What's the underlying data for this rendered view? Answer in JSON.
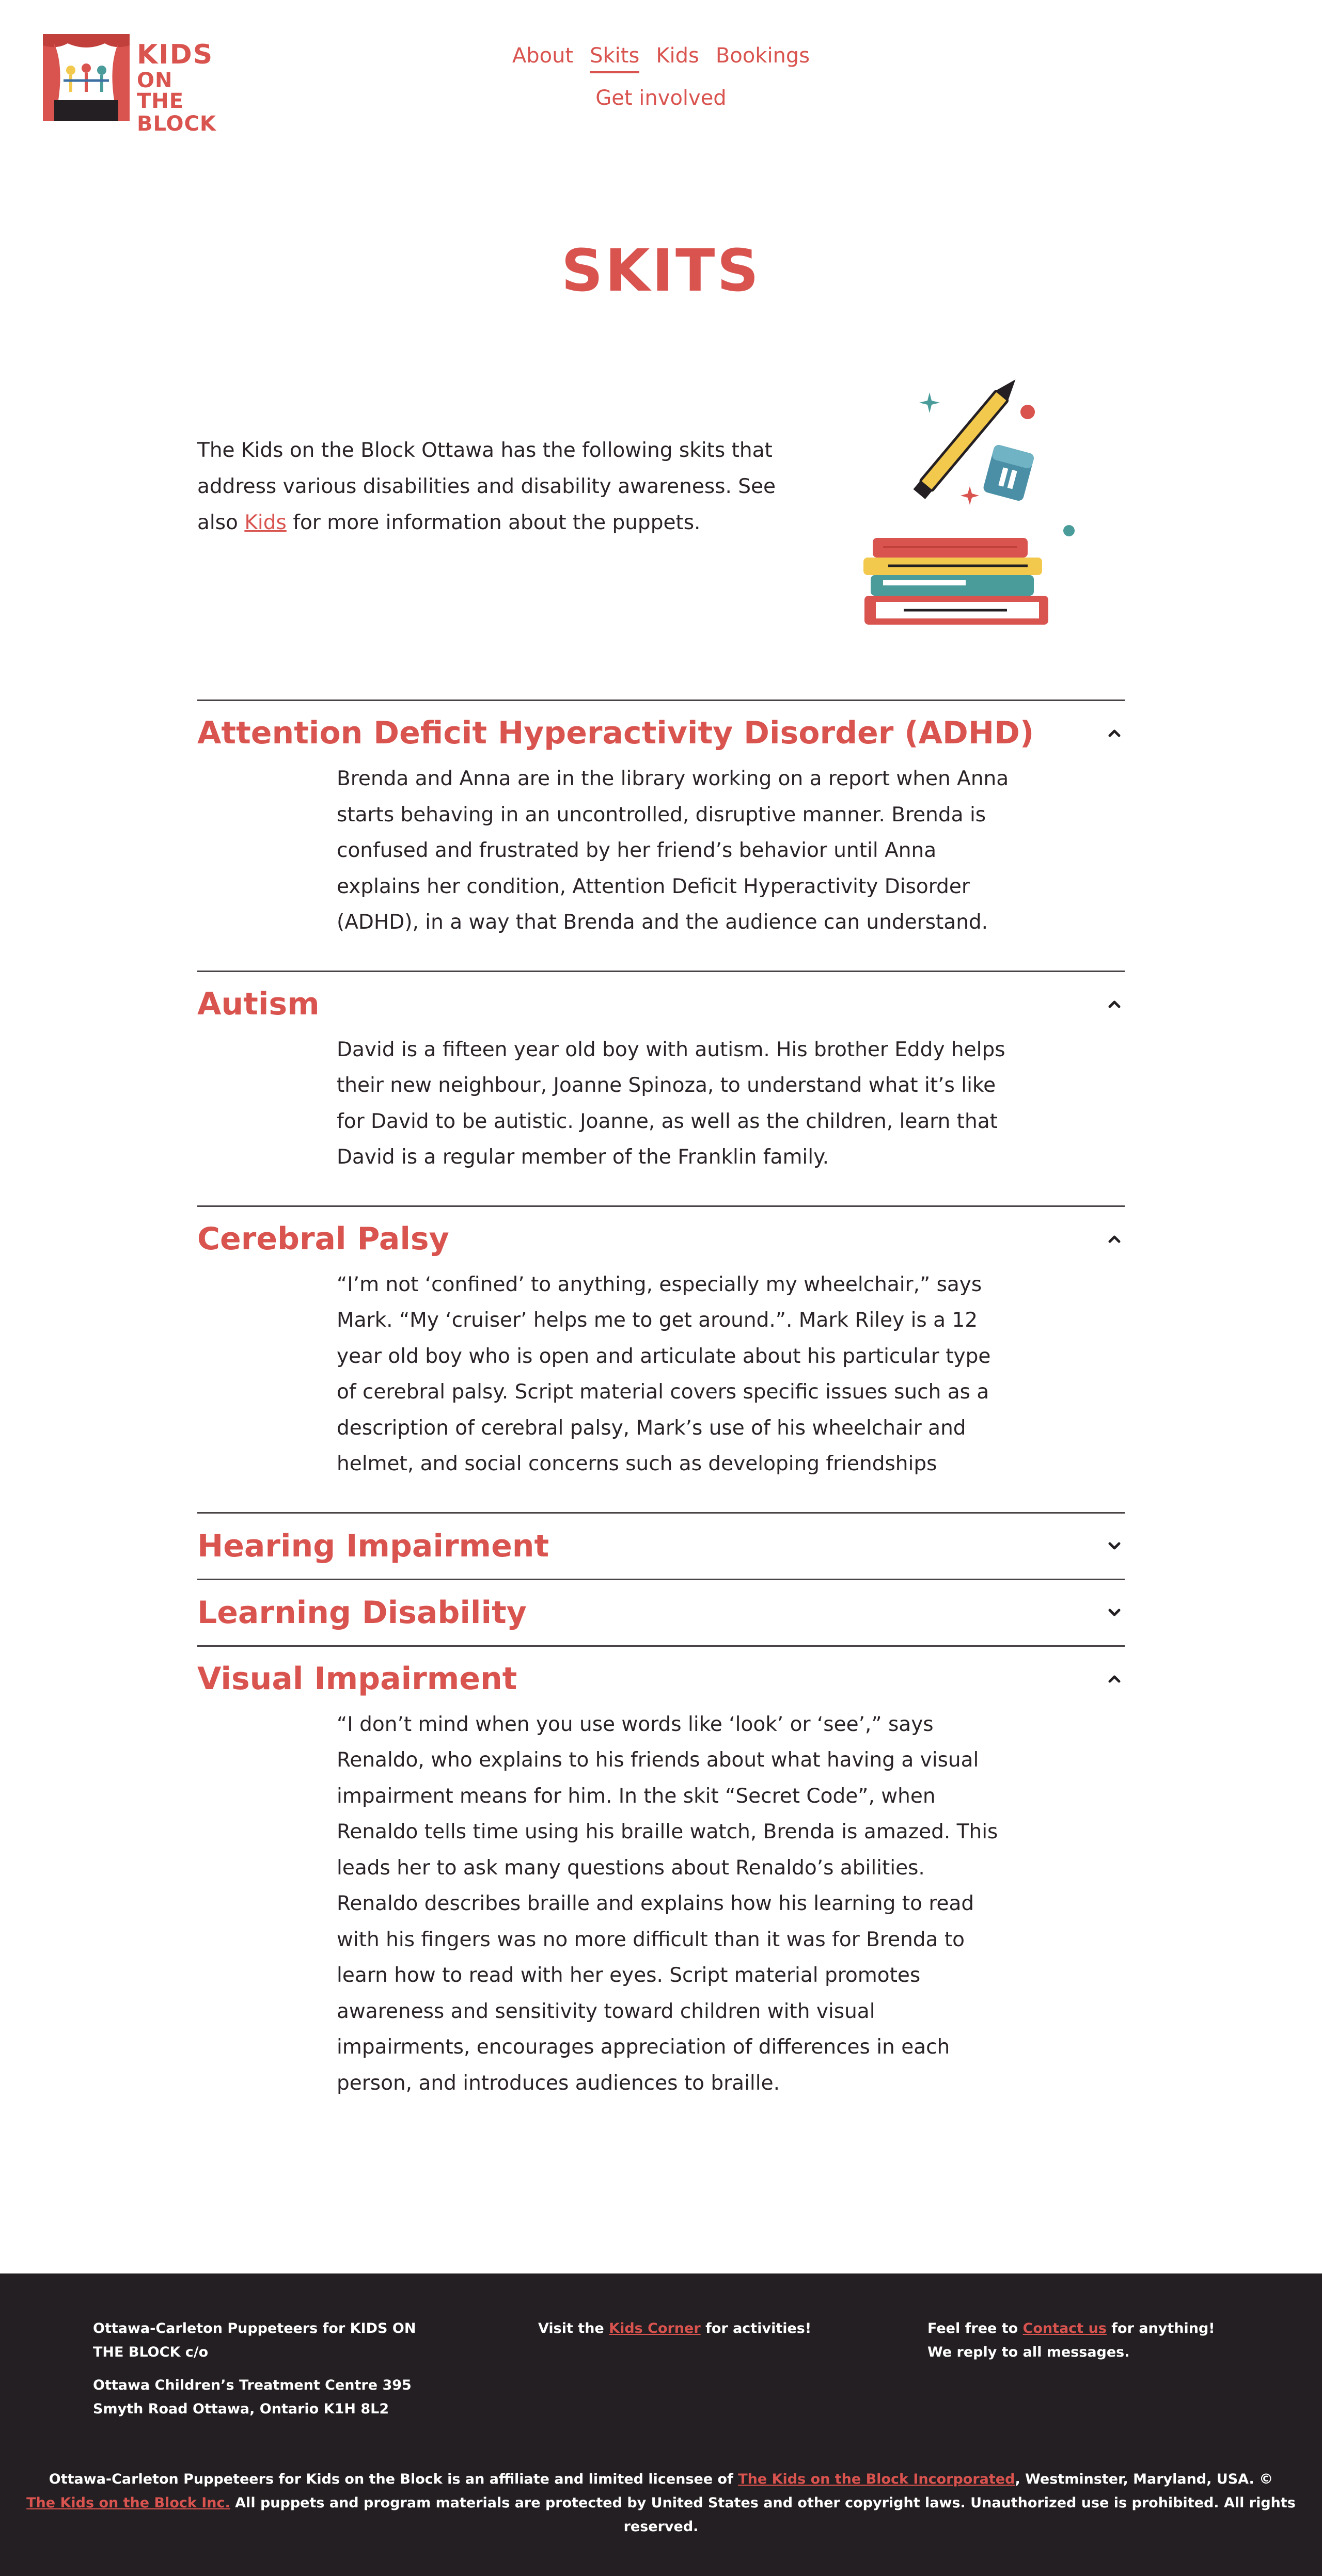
{
  "colors": {
    "accent": "#d9534f",
    "text": "#2a2328",
    "footer_bg": "#231f22",
    "divider": "#4a4448"
  },
  "logo": {
    "line1": "KIDS",
    "line2": "ON THE",
    "line3": "BLOCK"
  },
  "nav": {
    "items": [
      "About",
      "Skits",
      "Kids",
      "Bookings",
      "Get involved"
    ],
    "active": "Skits"
  },
  "page": {
    "title": "SKITS"
  },
  "intro": {
    "before": "The Kids on the Block Ottawa has the following skits that address various disabilities and disability awareness. See also ",
    "link": "Kids",
    "after": " for more information about the puppets."
  },
  "skits": [
    {
      "title": "Attention Deficit Hyperactivity Disorder (ADHD)",
      "expanded": true,
      "chevron": "chevron-up-icon",
      "body": "Brenda and Anna are in the library working on a report when Anna starts behaving in an uncontrolled, disruptive manner. Brenda is confused and frustrated by her friend’s behavior until Anna explains her condition, Attention Deficit Hyperactivity Disorder (ADHD), in a way that Brenda and the audience can understand."
    },
    {
      "title": "Autism",
      "expanded": true,
      "chevron": "chevron-up-icon",
      "body": "David is a fifteen year old boy with autism. His brother Eddy helps their new neighbour, Joanne Spinoza, to understand what it’s like for David to be autistic. Joanne, as well as the children, learn that David is a regular member of the Franklin family."
    },
    {
      "title": "Cerebral Palsy",
      "expanded": true,
      "chevron": "chevron-up-icon",
      "body": "“I’m not ‘confined’ to anything, especially my wheelchair,” says Mark. “My ‘cruiser’ helps me to get around.”. Mark Riley is a 12 year old boy who is open and articulate about his particular type of cerebral palsy. Script material covers specific issues such as a description of cerebral palsy, Mark’s use of his wheelchair and helmet, and social concerns such as developing friendships"
    },
    {
      "title": "Hearing Impairment",
      "expanded": false,
      "chevron": "chevron-down-icon",
      "body": ""
    },
    {
      "title": "Learning Disability",
      "expanded": false,
      "chevron": "chevron-down-icon",
      "body": ""
    },
    {
      "title": "Visual Impairment",
      "expanded": true,
      "chevron": "chevron-up-icon",
      "body": "“I don’t mind when you use words like ‘look’ or ‘see’,” says Renaldo, who explains to his friends about what having a visual impairment means for him. In the skit “Secret Code”, when Renaldo tells time using his braille watch, Brenda is amazed. This leads her to ask many questions about Renaldo’s abilities. Renaldo describes braille and explains how his learning to read with his fingers was no more difficult than it was for Brenda to learn how to read with her eyes. Script material promotes awareness and sensitivity toward children with visual impairments, encourages appreciation of differences in each person, and introduces audiences to braille."
    }
  ],
  "footer": {
    "col1": {
      "line1": "Ottawa-Carleton Puppeteers for KIDS ON THE BLOCK c/o",
      "line2": "Ottawa Children’s Treatment Centre 395 Smyth Road Ottawa, Ontario K1H 8L2"
    },
    "col2": {
      "before": "Visit the ",
      "link": "Kids Corner",
      "after": " for activities!"
    },
    "col3": {
      "before": "Feel free to ",
      "link": "Contact us",
      "after": " for anything! We reply to all messages."
    },
    "bottom": {
      "part1": "Ottawa-Carleton Puppeteers for Kids on the Block is an affiliate and limited licensee of ",
      "link1": "The Kids on the Block Incorporated",
      "part2": ", Westminster, Maryland, USA. ©",
      "link2": "The Kids on the Block Inc.",
      "part3": " All puppets and program materials are protected by United States and other copyright laws. Unauthorized use is prohibited. All rights reserved."
    }
  }
}
